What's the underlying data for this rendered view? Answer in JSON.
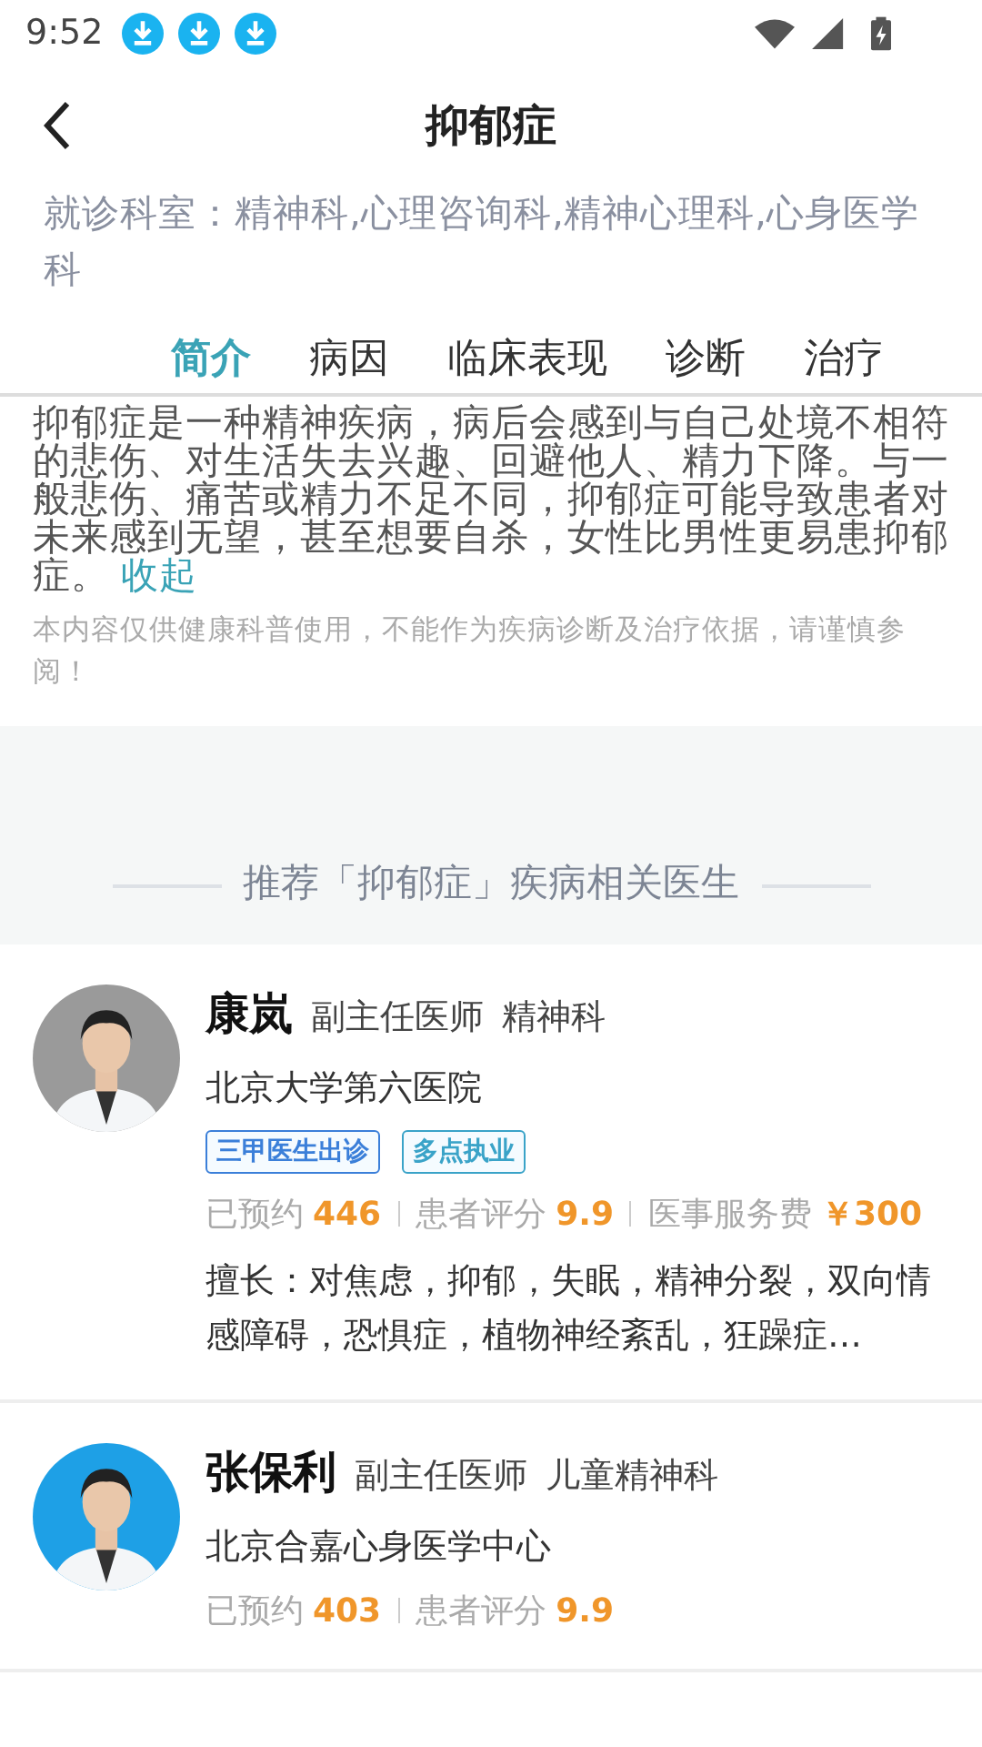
{
  "status_bar": {
    "time": "9:52",
    "notifications": [
      {
        "kind": "download"
      },
      {
        "kind": "download"
      },
      {
        "kind": "download"
      }
    ]
  },
  "header": {
    "title": "抑郁症"
  },
  "departments": "就诊科室：精神科,心理咨询科,精神心理科,心身医学科",
  "tabs": [
    {
      "label": "简介",
      "selected": true
    },
    {
      "label": "病因",
      "selected": false
    },
    {
      "label": "临床表现",
      "selected": false
    },
    {
      "label": "诊断",
      "selected": false
    },
    {
      "label": "治疗",
      "selected": false
    }
  ],
  "intro": {
    "text": "抑郁症是一种精神疾病，病后会感到与自己处境不相符的悲伤、对生活失去兴趣、回避他人、精力下降。与一般悲伤、痛苦或精力不足不同，抑郁症可能导致患者对未来感到无望，甚至想要自杀，女性比男性更易患抑郁症。",
    "collapse_link": "收起",
    "disclaimer": "本内容仅供健康科普使用，不能作为疾病诊断及治疗依据，请谨慎参阅！"
  },
  "recommend_heading": "推荐「抑郁症」疾病相关医生",
  "doctors": [
    {
      "name": "康岚",
      "title": "副主任医师",
      "department": "精神科",
      "hospital": "北京大学第六医院",
      "tags": [
        {
          "label": "三甲医生出诊",
          "color": "#3b7fd9"
        },
        {
          "label": "多点执业",
          "color": "#3aa3c8"
        }
      ],
      "stats": [
        {
          "label": "已预约",
          "value": "446"
        },
        {
          "label": "患者评分",
          "value": "9.9"
        },
        {
          "label": "医事服务费",
          "value": "￥300"
        }
      ],
      "specialty": "擅长：对焦虑，抑郁，失眠，精神分裂，双向情感障碍，恐惧症，植物神经紊乱，狂躁症…"
    },
    {
      "name": "张保利",
      "title": "副主任医师",
      "department": "儿童精神科",
      "hospital": "北京合嘉心身医学中心",
      "stats": [
        {
          "label": "已预约",
          "value": "403"
        },
        {
          "label": "患者评分",
          "value": "9.9"
        }
      ]
    }
  ]
}
